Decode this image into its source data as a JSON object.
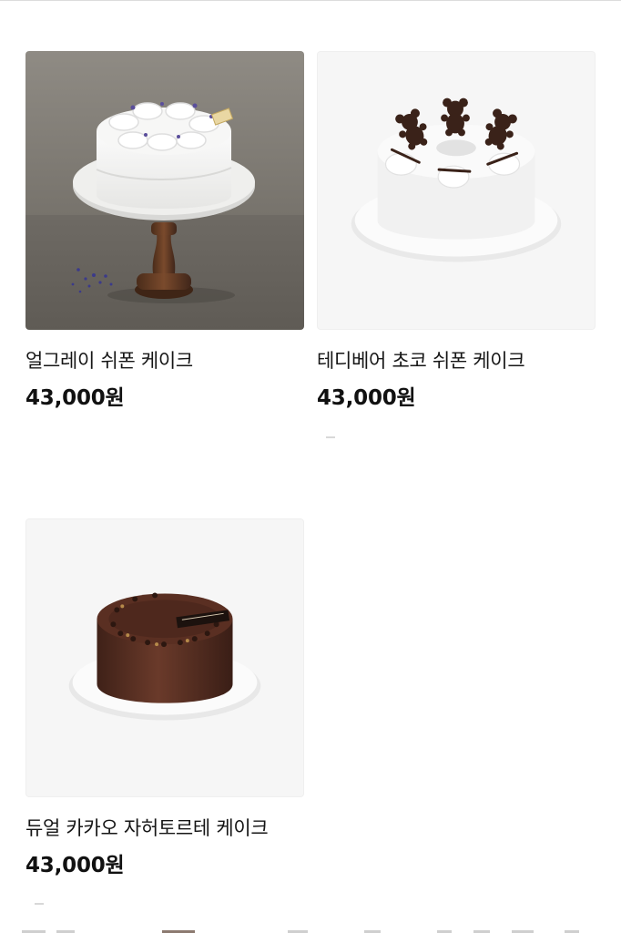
{
  "products": [
    {
      "name": "얼그레이 쉬폰 케이크",
      "price": "43,000원"
    },
    {
      "name": "테디베어 초코 쉬폰 케이크",
      "price": "43,000원"
    },
    {
      "name": "듀얼 카카오 자허토르테 케이크",
      "price": "43,000원"
    }
  ],
  "icons": {
    "earl_grey_cake": "earl-grey-cake-image",
    "teddy_cake": "teddy-bear-cake-image",
    "sachertorte": "chocolate-sachertorte-image"
  },
  "colors": {
    "text": "#111111",
    "background": "#ffffff",
    "placeholder": "#f6f6f6"
  }
}
